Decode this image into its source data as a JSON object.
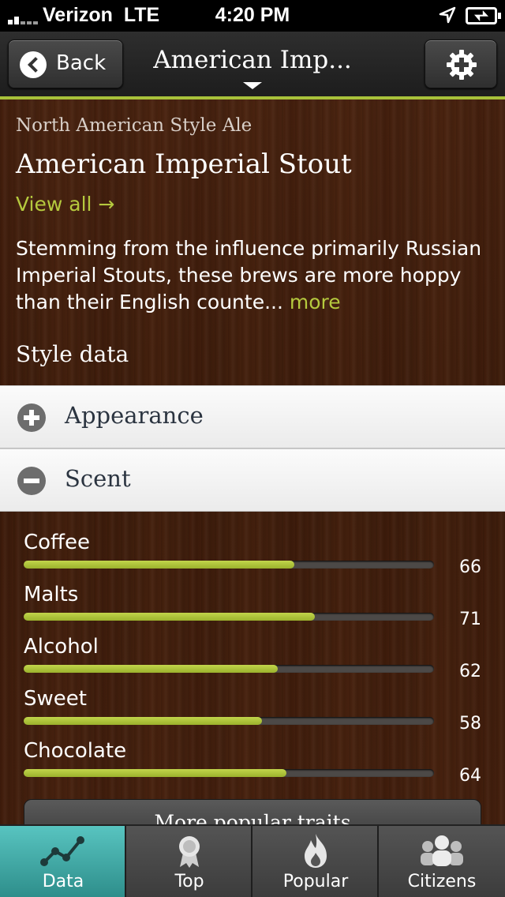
{
  "status_bar": {
    "carrier": "Verizon",
    "network": "LTE",
    "time": "4:20 PM"
  },
  "nav": {
    "back_label": "Back",
    "title": "American Imp..."
  },
  "style": {
    "family": "North American Style Ale",
    "name": "American Imperial Stout",
    "view_all": "View all →",
    "description": "Stemming from the influence primarily Russian Imperial Stouts, these brews are more hoppy than their English counte...",
    "more_link": "more",
    "section_heading": "Style data"
  },
  "accordion": [
    {
      "label": "Appearance",
      "expanded": false
    },
    {
      "label": "Scent",
      "expanded": true
    }
  ],
  "traits": [
    {
      "name": "Coffee",
      "value": "66",
      "fill_percent": 66
    },
    {
      "name": "Malts",
      "value": "71",
      "fill_percent": 71
    },
    {
      "name": "Alcohol",
      "value": "62",
      "fill_percent": 62
    },
    {
      "name": "Sweet",
      "value": "58",
      "fill_percent": 58
    },
    {
      "name": "Chocolate",
      "value": "64",
      "fill_percent": 64
    }
  ],
  "more_traits_label": "More popular traits",
  "tabs": [
    {
      "label": "Data",
      "icon": "chart-line-icon",
      "active": true
    },
    {
      "label": "Top",
      "icon": "award-ribbon-icon",
      "active": false
    },
    {
      "label": "Popular",
      "icon": "flame-icon",
      "active": false
    },
    {
      "label": "Citizens",
      "icon": "people-icon",
      "active": false
    }
  ],
  "colors": {
    "accent": "#b5c93e",
    "active_tab": "#3aa7a3",
    "wood": "#45210f"
  }
}
